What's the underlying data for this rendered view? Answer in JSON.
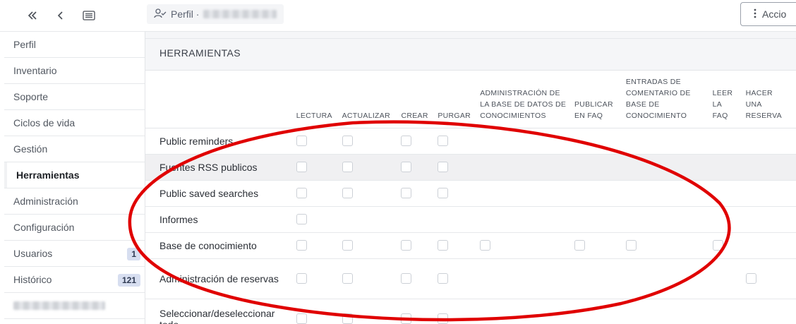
{
  "nav": {
    "collapse_icon": "double-chevron-left-icon",
    "back_icon": "chevron-left-icon",
    "list_icon": "list-icon"
  },
  "breadcrumb": {
    "label": "Perfil ·",
    "icon": "user-check-icon"
  },
  "actions": {
    "label": "Accio",
    "icon": "vertical-dots-icon"
  },
  "sidebar": {
    "items": [
      {
        "label": "Perfil"
      },
      {
        "label": "Inventario"
      },
      {
        "label": "Soporte"
      },
      {
        "label": "Ciclos de vida"
      },
      {
        "label": "Gestión"
      },
      {
        "label": "Herramientas",
        "active": true
      },
      {
        "label": "Administración"
      },
      {
        "label": "Configuración"
      },
      {
        "label": "Usuarios",
        "badge": "1"
      },
      {
        "label": "Histórico",
        "badge": "121"
      }
    ]
  },
  "section": {
    "title": "HERRAMIENTAS"
  },
  "columns": [
    {
      "label": "LECTURA"
    },
    {
      "label": "ACTUALIZAR"
    },
    {
      "label": "CREAR"
    },
    {
      "label": "PURGAR"
    },
    {
      "label": "ADMINISTRACIÓN DE LA BASE DE DATOS DE CONOCIMIENTOS"
    },
    {
      "label": "PUBLICAR EN FAQ"
    },
    {
      "label": "ENTRADAS DE COMENTARIO DE BASE DE CONOCIMIENTO"
    },
    {
      "label": "LEER LA FAQ"
    },
    {
      "label": "HACER UNA RESERVA"
    }
  ],
  "rows": [
    {
      "label": "Public reminders",
      "cells": [
        1,
        1,
        1,
        1,
        0,
        0,
        0,
        0,
        0
      ]
    },
    {
      "label": "Fuentes RSS publicos",
      "cells": [
        1,
        1,
        1,
        1,
        0,
        0,
        0,
        0,
        0
      ]
    },
    {
      "label": "Public saved searches",
      "cells": [
        1,
        1,
        1,
        1,
        0,
        0,
        0,
        0,
        0
      ]
    },
    {
      "label": "Informes",
      "cells": [
        1,
        0,
        0,
        0,
        0,
        0,
        0,
        0,
        0
      ]
    },
    {
      "label": "Base de conocimiento",
      "cells": [
        1,
        1,
        1,
        1,
        1,
        1,
        1,
        1,
        0
      ]
    },
    {
      "label": "Administración de reservas",
      "cells": [
        1,
        1,
        1,
        1,
        0,
        0,
        0,
        0,
        1
      ]
    },
    {
      "label": "Seleccionar/deseleccionar todo",
      "cells": [
        1,
        1,
        1,
        1,
        0,
        0,
        0,
        0,
        0
      ]
    }
  ]
}
